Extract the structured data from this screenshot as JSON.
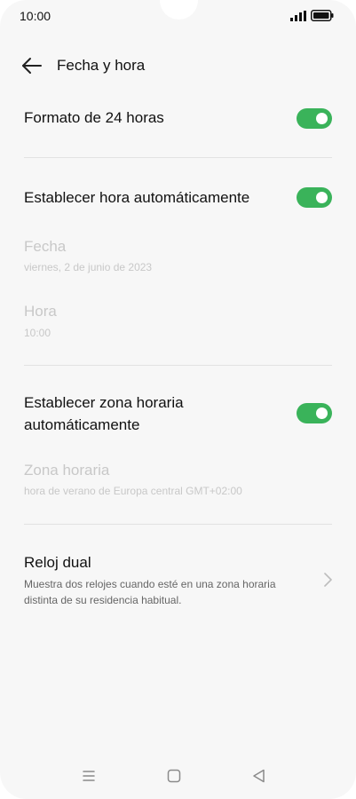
{
  "status_bar": {
    "time": "10:00",
    "icons": [
      "signal-icon",
      "battery-icon"
    ]
  },
  "header": {
    "back_icon": "arrow-left-icon",
    "title": "Fecha y hora"
  },
  "settings": {
    "format_24h": {
      "label": "Formato de 24 horas",
      "enabled": true
    },
    "auto_time": {
      "label": "Establecer hora automáticamente",
      "enabled": true
    },
    "date": {
      "label": "Fecha",
      "value": "viernes, 2 de junio de 2023",
      "disabled": true
    },
    "time": {
      "label": "Hora",
      "value": "10:00",
      "disabled": true
    },
    "auto_timezone": {
      "label_line1": "Establecer zona horaria",
      "label_line2": "automáticamente",
      "enabled": true
    },
    "timezone": {
      "label": "Zona horaria",
      "value": "hora de verano de Europa central GMT+02:00",
      "disabled": true
    },
    "dual_clock": {
      "label": "Reloj dual",
      "desc_line1": "Muestra dos relojes cuando esté en una zona horaria",
      "desc_line2": "distinta de su residencia habitual."
    }
  },
  "navbar": {
    "icons": [
      "menu-icon",
      "home-icon",
      "back-triangle-icon"
    ]
  },
  "colors": {
    "accent": "#3ab35a",
    "background": "#f7f7f7",
    "disabled_text": "#c8c8c8",
    "divider": "#e2e2e2"
  }
}
